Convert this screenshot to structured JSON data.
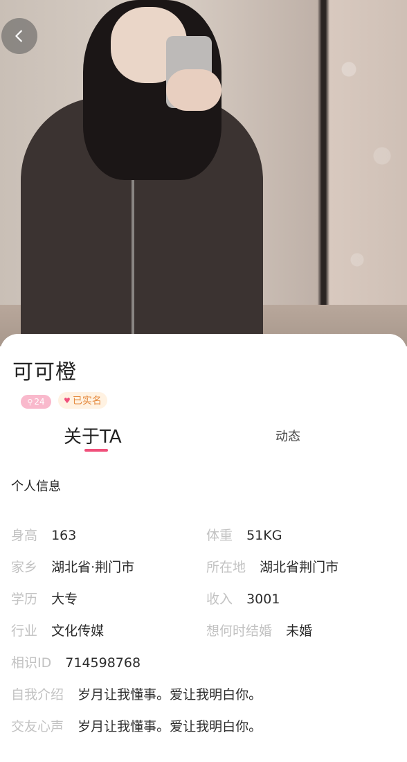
{
  "profile": {
    "name": "可可橙",
    "level_badge": "24",
    "verified_badge": "已实名"
  },
  "tabs": {
    "about": "关于TA",
    "moments": "动态"
  },
  "section": {
    "title": "个人信息"
  },
  "info": {
    "height_label": "身高",
    "height_value": "163",
    "weight_label": "体重",
    "weight_value": "51KG",
    "hometown_label": "家乡",
    "hometown_value": "湖北省·荆门市",
    "location_label": "所在地",
    "location_value": "湖北省荆门市",
    "education_label": "学历",
    "education_value": "大专",
    "income_label": "收入",
    "income_value": "3001",
    "industry_label": "行业",
    "industry_value": "文化传媒",
    "marriage_label": "想何时结婚",
    "marriage_value": "未婚",
    "id_label": "相识ID",
    "id_value": "714598768",
    "intro_label": "自我介绍",
    "intro_value": "岁月让我懂事。爱让我明白你。",
    "friend_label": "交友心声",
    "friend_value": "岁月让我懂事。爱让我明白你。"
  },
  "colors": {
    "accent": "#f0507b",
    "label_gray": "#c2c2c2",
    "verified_text": "#e58a3f"
  },
  "icons": {
    "back": "chevron-left-icon",
    "level": "search-heart-icon",
    "verified": "heart-icon"
  }
}
